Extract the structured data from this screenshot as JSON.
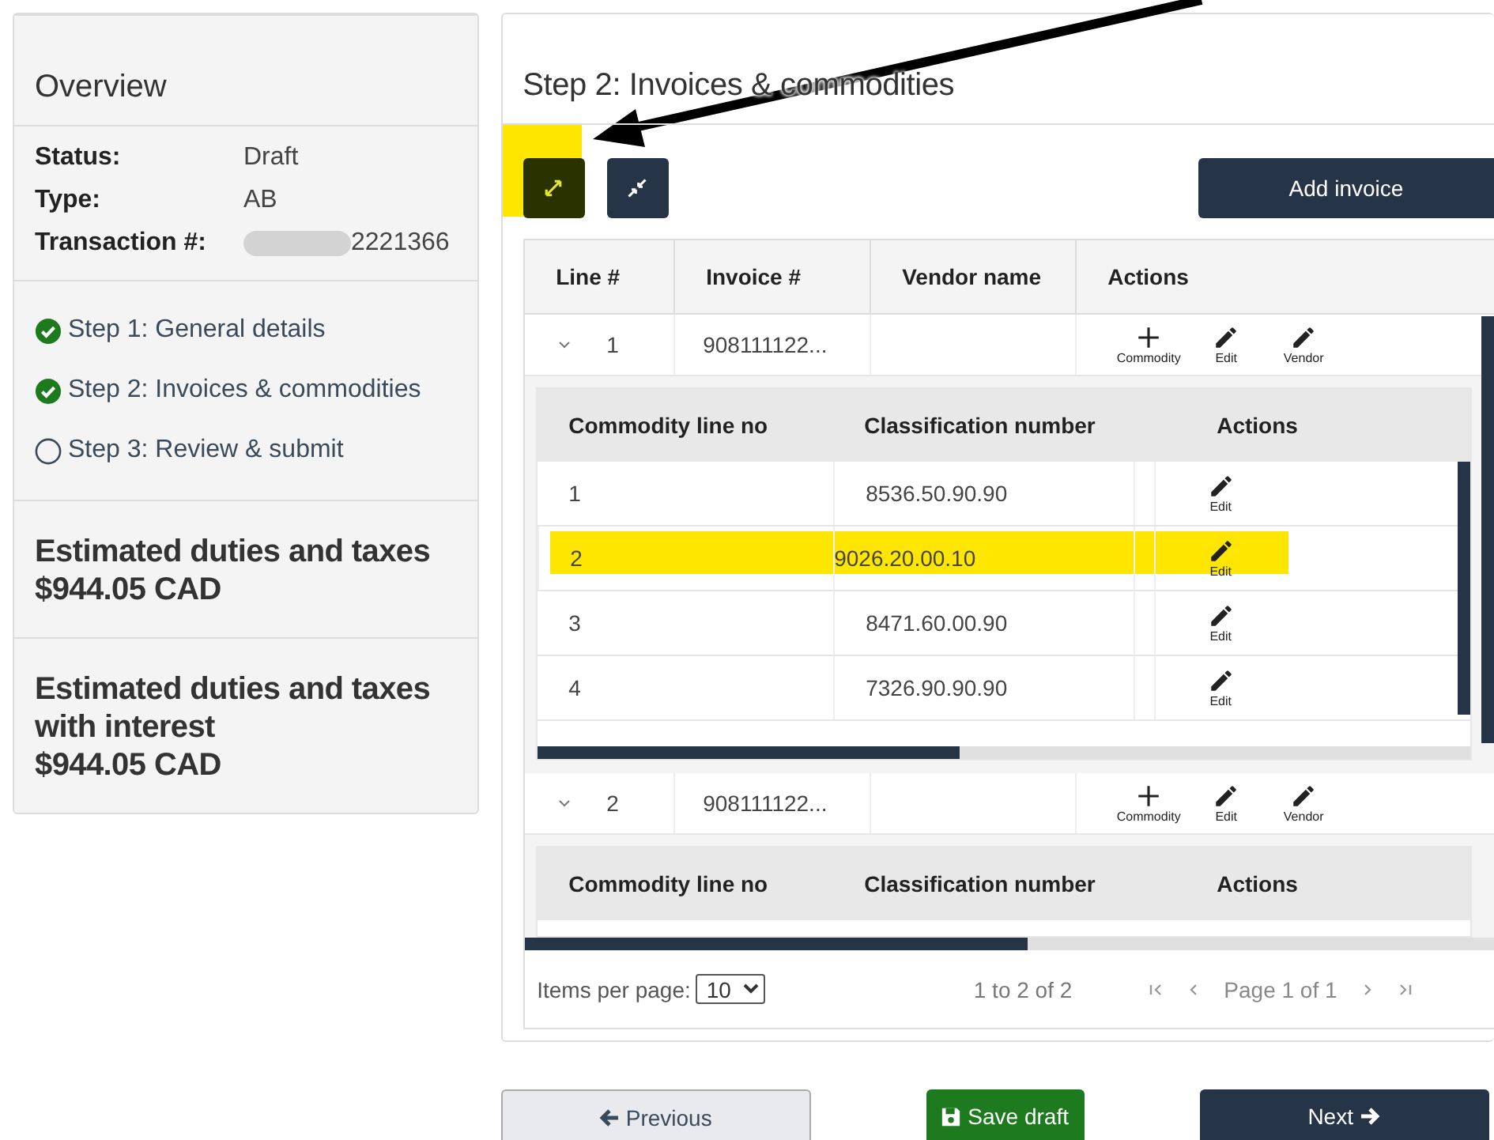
{
  "overview": {
    "title": "Overview",
    "fields": [
      {
        "label": "Status:",
        "value": "Draft",
        "redacted": false
      },
      {
        "label": "Type:",
        "value": "AB",
        "redacted": false
      },
      {
        "label": "Transaction #:",
        "value": "2221366",
        "redacted": true
      }
    ],
    "steps": [
      {
        "label": "Step 1: General details",
        "done": true
      },
      {
        "label": "Step 2: Invoices & commodities",
        "done": true
      },
      {
        "label": "Step 3: Review & submit",
        "done": false
      }
    ],
    "totals": [
      {
        "label": "Estimated duties and taxes",
        "amount": "$944.05 CAD"
      },
      {
        "label": "Estimated duties and taxes with interest",
        "amount": "$944.05 CAD"
      }
    ]
  },
  "page": {
    "title": "Step 2: Invoices & commodities",
    "toolbar": [
      {
        "kind": "expand",
        "highlighted": true
      },
      {
        "kind": "collapse",
        "highlighted": false
      }
    ],
    "add_button": "Add invoice"
  },
  "invoices": {
    "columns": [
      "Line #",
      "Invoice #",
      "Vendor name",
      "Actions"
    ],
    "rows": [
      {
        "line": "1",
        "invoice": "908111122...",
        "expanded": true,
        "actions": [
          {
            "kind": "add",
            "label": "Commodity"
          },
          {
            "kind": "edit",
            "label": "Edit"
          },
          {
            "kind": "edit",
            "label": "Vendor"
          }
        ],
        "commodities": {
          "columns": [
            "Commodity line no",
            "Classification number",
            "Actions"
          ],
          "rows": [
            {
              "line": "1",
              "classification": "8536.50.90.90",
              "action": "Edit",
              "highlighted": false
            },
            {
              "line": "2",
              "classification": "9026.20.00.10",
              "action": "Edit",
              "highlighted": true
            },
            {
              "line": "3",
              "classification": "8471.60.00.90",
              "action": "Edit",
              "highlighted": false
            },
            {
              "line": "4",
              "classification": "7326.90.90.90",
              "action": "Edit",
              "highlighted": false
            }
          ]
        }
      },
      {
        "line": "2",
        "invoice": "908111122...",
        "expanded": true,
        "actions": [
          {
            "kind": "add",
            "label": "Commodity"
          },
          {
            "kind": "edit",
            "label": "Edit"
          },
          {
            "kind": "edit",
            "label": "Vendor"
          }
        ],
        "commodities": {
          "columns": [
            "Commodity line no",
            "Classification number",
            "Actions"
          ]
        }
      }
    ]
  },
  "pagination": {
    "items_per_page_label": "Items per page:",
    "page_size": "10",
    "range": "1 to 2 of 2",
    "page_label": "Page 1 of 1"
  },
  "footer": {
    "previous": "Previous",
    "save": "Save draft",
    "next": "Next"
  },
  "annotations": [
    {
      "kind": "arrow"
    }
  ]
}
